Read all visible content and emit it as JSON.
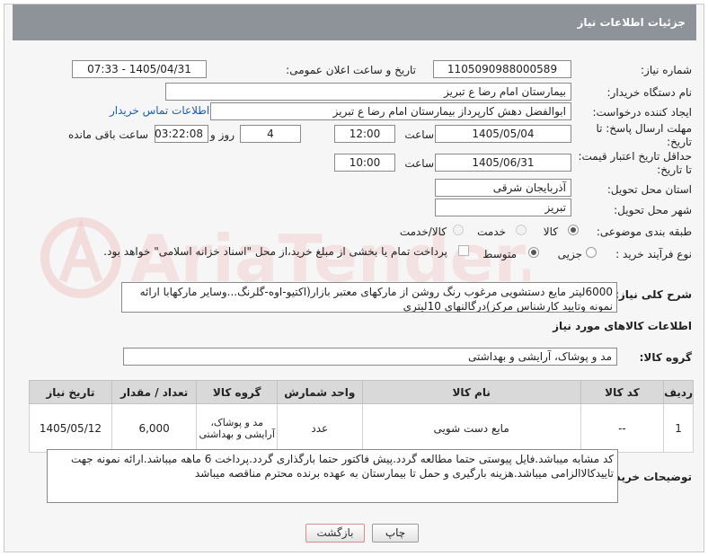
{
  "header": {
    "title": "جزئیات اطلاعات نیاز"
  },
  "fields": {
    "need_number_label": "شماره نیاز:",
    "need_number": "1105090988000589",
    "announce_label": "تاریخ و ساعت اعلان عمومی:",
    "announce_value": "1405/04/31 - 07:33",
    "buyer_org_label": "نام دستگاه خریدار:",
    "buyer_org": "بیمارستان امام رضا  ع  تبریز",
    "creator_label": "ایجاد کننده درخواست:",
    "creator": "ابوالفضل دهش کارپرداز بیمارستان امام رضا  ع  تبریز",
    "contact_link": "اطلاعات تماس خریدار",
    "deadline_label_1": "مهلت ارسال پاسخ: تا",
    "deadline_label_2": "تاریخ:",
    "deadline_date": "1405/05/04",
    "time_label": "ساعت",
    "deadline_time": "12:00",
    "days_value": "4",
    "days_label": "روز و",
    "remaining_time": "03:22:08",
    "remaining_label": "ساعت باقی مانده",
    "validity_label_1": "حداقل تاریخ اعتبار قیمت:",
    "validity_label_2": "تا تاریخ:",
    "validity_date": "1405/06/31",
    "validity_time": "10:00",
    "province_label": "استان محل تحویل:",
    "province": "آذربایجان شرقی",
    "city_label": "شهر محل تحویل:",
    "city": "تبریز",
    "category_label": "طبقه بندی موضوعی:",
    "category_options": [
      "کالا",
      "خدمت",
      "کالا/خدمت"
    ],
    "process_label": "نوع فرآیند خرید :",
    "process_options": [
      "جزیی",
      "متوسط"
    ],
    "payment_note": "پرداخت تمام یا بخشی از مبلغ خرید،از محل \"اسناد خزانه اسلامی\" خواهد بود."
  },
  "description": {
    "label": "شرح کلی نیاز:",
    "text": "6000لیتر مایع دستشویی مرغوب رنگ روشن از مارکهای معتبر بازار(اکتیو-اوه-گلرنگ...وسایر مارکهابا ارائه نمونه وتایید کارشناس مرکز)درگالنهای 10لیتری"
  },
  "goods_info_title": "اطلاعات کالاهای مورد نیاز",
  "goods_group": {
    "label": "گروه کالا:",
    "value": "مد و پوشاک، آرایشی و بهداشتی"
  },
  "table": {
    "headers": [
      "ردیف",
      "کد کالا",
      "نام کالا",
      "واحد شمارش",
      "گروه کالا",
      "تعداد / مقدار",
      "تاریخ نیاز"
    ],
    "rows": [
      {
        "row": "1",
        "code": "--",
        "name": "مایع دست شویی",
        "unit": "عدد",
        "group": "مد و پوشاک، آرایشی و بهداشتی",
        "qty": "6,000",
        "date": "1405/05/12"
      }
    ]
  },
  "buyer_notes": {
    "label": "توضیحات خریدار:",
    "text": "کد مشابه میباشد.فایل پیوستی حتما مطالعه گردد.پیش فاکتور حتما بارگذاری گردد.پرداخت 6 ماهه میباشد.ارائه نمونه جهت تاییدکالاالزامی میباشد.هزینه بارگیری و حمل تا بیمارستان به عهده برنده محترم مناقصه میباشد"
  },
  "buttons": {
    "print": "چاپ",
    "back": "بازگشت"
  },
  "colors": {
    "header_bg": "#8d9399",
    "link": "#1a5fb4",
    "watermark": "#e8a0a0"
  }
}
